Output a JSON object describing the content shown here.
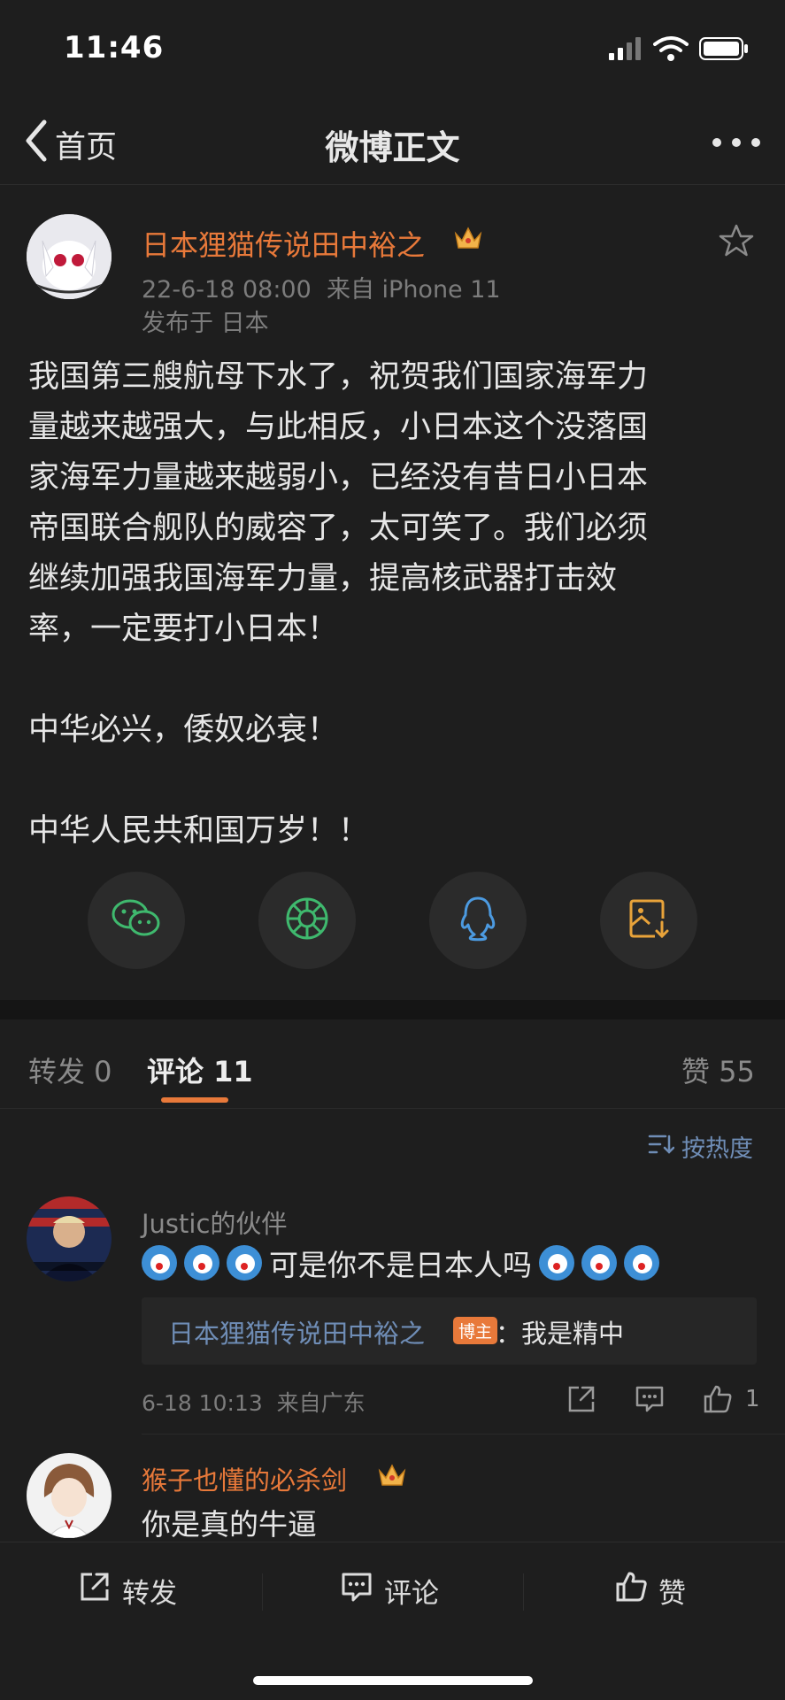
{
  "status_bar": {
    "time": "11:46"
  },
  "nav": {
    "back_label": "首页",
    "title": "微博正文"
  },
  "post": {
    "author": "日本狸猫传说田中裕之",
    "timestamp": "22-6-18 08:00",
    "source": "来自 iPhone 11",
    "location": "发布于 日本",
    "text": "我国第三艘航母下水了，祝贺我们国家海军力\n量越来越强大，与此相反，小日本这个没落国\n家海军力量越来越弱小，已经没有昔日小日本\n帝国联合舰队的威容了，太可笑了。我们必须\n继续加强我国海军力量，提高核武器打击效\n率，一定要打小日本！\n\n中华必兴，倭奴必衰！\n\n中华人民共和国万岁！！"
  },
  "share_icons": [
    "wechat-icon",
    "moments-icon",
    "qq-icon",
    "save-image-icon"
  ],
  "tabs": {
    "repost": "转发 0",
    "comment": "评论 11",
    "like": "赞 55"
  },
  "sort_label": "按热度",
  "comments": [
    {
      "user": "Justic的伙伴",
      "text": "可是你不是日本人吗",
      "reply_author": "日本狸猫传说田中裕之",
      "reply_badge": "博主",
      "reply_text": "：我是精中",
      "time": "6-18 10:13",
      "location": "来自广东",
      "likes": "1"
    },
    {
      "user": "猴子也懂的必杀剑",
      "text": "你是真的牛逼"
    }
  ],
  "bottom_bar": {
    "repost": "转发",
    "comment": "评论",
    "like": "赞"
  },
  "colors": {
    "accent": "#e8793a",
    "link": "#6f8db6",
    "background": "#1e1e1e"
  }
}
